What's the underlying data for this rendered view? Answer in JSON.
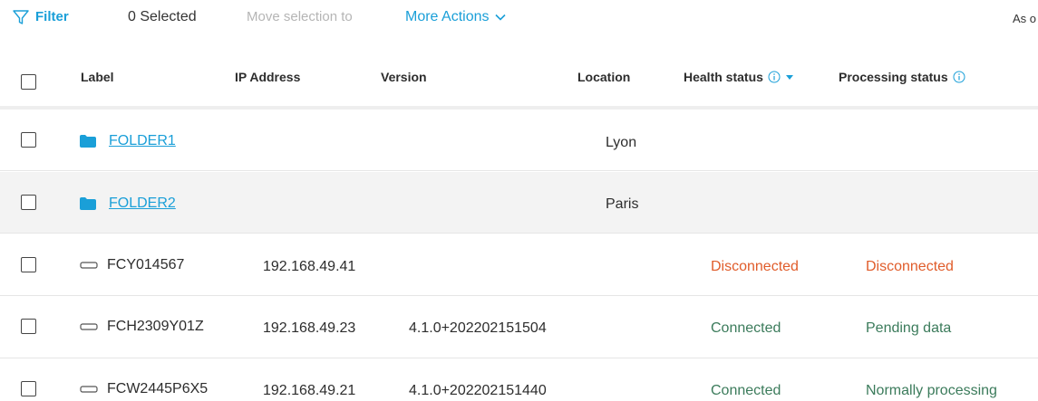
{
  "toolbar": {
    "filter_label": "Filter",
    "selected_label": "0 Selected",
    "move_label": "Move selection to",
    "more_actions_label": "More Actions",
    "as_of_label": "As o"
  },
  "colors": {
    "accent": "#1a9fd8",
    "disconnected": "#e05c2a",
    "connected": "#3b7b5b"
  },
  "table": {
    "columns": {
      "label": "Label",
      "ip": "IP Address",
      "version": "Version",
      "location": "Location",
      "health": "Health status",
      "processing": "Processing status"
    },
    "rows": [
      {
        "type": "folder",
        "label": "FOLDER1",
        "ip": "",
        "version": "",
        "location": "Lyon",
        "health": "",
        "processing": ""
      },
      {
        "type": "folder",
        "label": "FOLDER2",
        "ip": "",
        "version": "",
        "location": "Paris",
        "health": "",
        "processing": ""
      },
      {
        "type": "device",
        "label": "FCY014567",
        "ip": "192.168.49.41",
        "version": "",
        "location": "",
        "health": "Disconnected",
        "processing": "Disconnected"
      },
      {
        "type": "device",
        "label": "FCH2309Y01Z",
        "ip": "192.168.49.23",
        "version": "4.1.0+202202151504",
        "location": "",
        "health": "Connected",
        "processing": "Pending data"
      },
      {
        "type": "device",
        "label": "FCW2445P6X5",
        "ip": "192.168.49.21",
        "version": "4.1.0+202202151440",
        "location": "",
        "health": "Connected",
        "processing": "Normally processing"
      }
    ]
  }
}
